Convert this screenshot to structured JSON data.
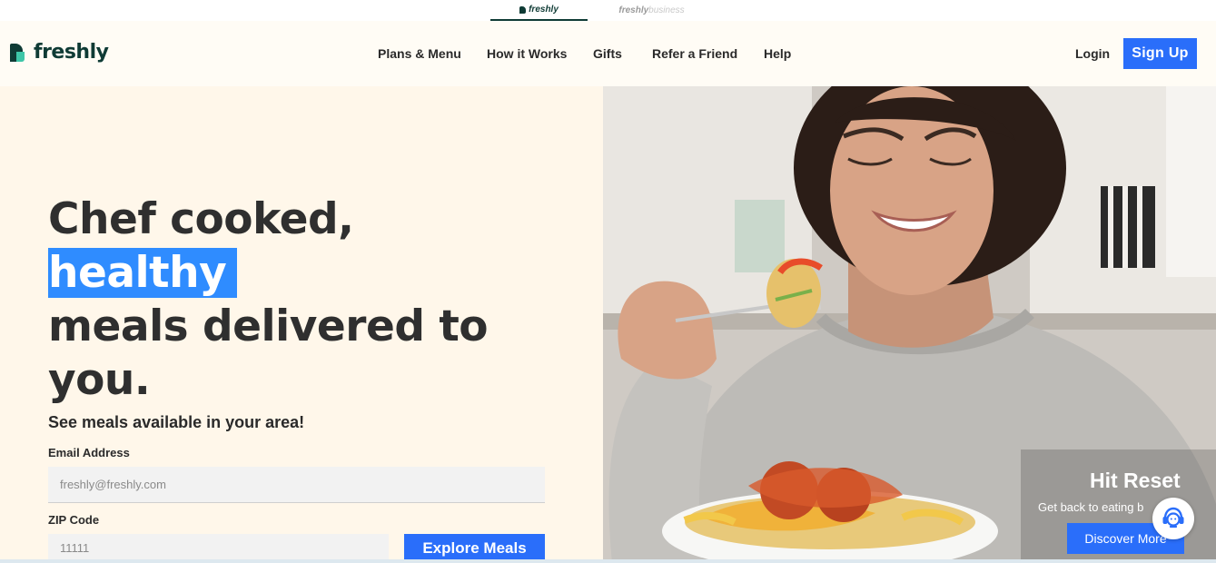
{
  "brand_switcher": {
    "tabs": [
      {
        "label": "freshly",
        "active": true
      },
      {
        "label": "freshly",
        "suffix": "business",
        "active": false
      }
    ]
  },
  "header": {
    "logo_text": "freshly",
    "nav": [
      {
        "label": "Plans & Menu"
      },
      {
        "label": "How it Works"
      },
      {
        "label": "Gifts"
      },
      {
        "label": "Refer a Friend"
      },
      {
        "label": "Help"
      }
    ],
    "login_label": "Login",
    "signup_label": "Sign Up"
  },
  "hero": {
    "headline_pre": "Chef cooked, ",
    "headline_highlight": "healthy",
    "headline_line2": "meals delivered to",
    "headline_line3": "you.",
    "subhead": "See meals available in your area!",
    "email_label": "Email Address",
    "email_placeholder": "freshly@freshly.com",
    "zip_label": "ZIP Code",
    "zip_placeholder": "11111",
    "explore_label": "Explore Meals"
  },
  "promo": {
    "title": "Hit Reset",
    "subtitle": "Get back to eating b",
    "button_label": "Discover More"
  },
  "colors": {
    "brand_green": "#0f3b35",
    "brand_mint": "#3ec6a8",
    "accent_blue": "#2a6efa",
    "highlight_blue": "#2f8cff",
    "hero_bg": "#fff7ea"
  },
  "icons": {
    "chat": "support-headset-icon"
  }
}
